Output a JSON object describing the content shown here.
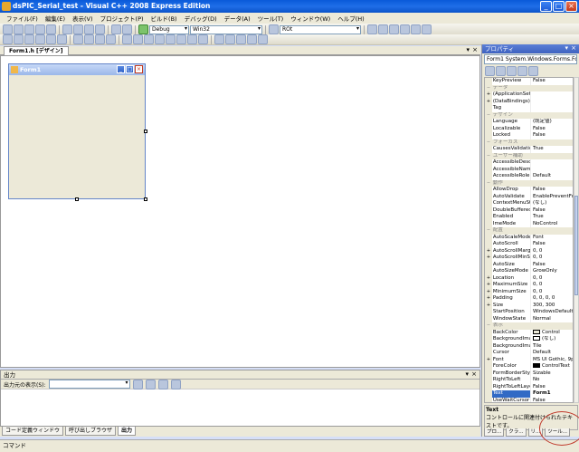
{
  "window": {
    "title": "dsPIC_Serial_test - Visual C++ 2008 Express Edition"
  },
  "menubar": [
    "ファイル(F)",
    "編集(E)",
    "表示(V)",
    "プロジェクト(P)",
    "ビルド(B)",
    "デバッグ(D)",
    "データ(A)",
    "ツール(T)",
    "ウィンドウ(W)",
    "ヘルプ(H)"
  ],
  "toolbar": {
    "config": "Debug",
    "platform": "Win32",
    "find_text": "ROt"
  },
  "document_tab": "Form1.h [デザイン]",
  "form1": {
    "title": "Form1"
  },
  "output": {
    "title": "出力",
    "source_label": "出力元の表示(S):"
  },
  "bottom_tabs": [
    "コード定義ウィンドウ",
    "呼び出しブラウザ",
    "出力"
  ],
  "status": "コマンド",
  "properties": {
    "title": "プロパティ",
    "object": "Form1 System.Windows.Forms.Form",
    "rows": [
      {
        "t": "p",
        "n": "KeyPreview",
        "v": "False"
      },
      {
        "t": "c",
        "n": "データ"
      },
      {
        "t": "p",
        "e": "+",
        "n": "(ApplicationSetti",
        "v": ""
      },
      {
        "t": "p",
        "e": "+",
        "n": "(DataBindings)",
        "v": ""
      },
      {
        "t": "p",
        "n": "Tag",
        "v": ""
      },
      {
        "t": "c",
        "n": "デザイン"
      },
      {
        "t": "p",
        "n": "Language",
        "v": "(既定値)"
      },
      {
        "t": "p",
        "n": "Localizable",
        "v": "False"
      },
      {
        "t": "p",
        "n": "Locked",
        "v": "False"
      },
      {
        "t": "c",
        "n": "フォーカス"
      },
      {
        "t": "p",
        "n": "CausesValidatio",
        "v": "True"
      },
      {
        "t": "c",
        "n": "ユーザー補助"
      },
      {
        "t": "p",
        "n": "AccessibleDescr",
        "v": ""
      },
      {
        "t": "p",
        "n": "AccessibleName",
        "v": ""
      },
      {
        "t": "p",
        "n": "AccessibleRole",
        "v": "Default"
      },
      {
        "t": "c",
        "n": "動作"
      },
      {
        "t": "p",
        "n": "AllowDrop",
        "v": "False"
      },
      {
        "t": "p",
        "n": "AutoValidate",
        "v": "EnablePreventFoc"
      },
      {
        "t": "p",
        "n": "ContextMenuStri",
        "v": "(なし)"
      },
      {
        "t": "p",
        "n": "DoubleBuffered",
        "v": "False"
      },
      {
        "t": "p",
        "n": "Enabled",
        "v": "True"
      },
      {
        "t": "p",
        "n": "ImeMode",
        "v": "NoControl"
      },
      {
        "t": "c",
        "n": "配置"
      },
      {
        "t": "p",
        "n": "AutoScaleMode",
        "v": "Font"
      },
      {
        "t": "p",
        "n": "AutoScroll",
        "v": "False"
      },
      {
        "t": "p",
        "e": "+",
        "n": "AutoScrollMargi",
        "v": "0, 0"
      },
      {
        "t": "p",
        "e": "+",
        "n": "AutoScrollMinSiz",
        "v": "0, 0"
      },
      {
        "t": "p",
        "n": "AutoSize",
        "v": "False"
      },
      {
        "t": "p",
        "n": "AutoSizeMode",
        "v": "GrowOnly"
      },
      {
        "t": "p",
        "e": "+",
        "n": "Location",
        "v": "0, 0"
      },
      {
        "t": "p",
        "e": "+",
        "n": "MaximumSize",
        "v": "0, 0"
      },
      {
        "t": "p",
        "e": "+",
        "n": "MinimumSize",
        "v": "0, 0"
      },
      {
        "t": "p",
        "e": "+",
        "n": "Padding",
        "v": "0, 0, 0, 0"
      },
      {
        "t": "p",
        "e": "+",
        "n": "Size",
        "v": "300, 300"
      },
      {
        "t": "p",
        "n": "StartPosition",
        "v": "WindowsDefaultLo"
      },
      {
        "t": "p",
        "n": "WindowState",
        "v": "Normal"
      },
      {
        "t": "c",
        "n": "表示"
      },
      {
        "t": "p",
        "n": "BackColor",
        "v": "Control",
        "sw": "#ece9d8"
      },
      {
        "t": "p",
        "n": "BackgroundImag",
        "v": "(なし)",
        "sw": "#ffffff"
      },
      {
        "t": "p",
        "n": "BackgroundImag",
        "v": "Tile"
      },
      {
        "t": "p",
        "n": "Cursor",
        "v": "Default"
      },
      {
        "t": "p",
        "e": "+",
        "n": "Font",
        "v": "MS UI Gothic, 9pt"
      },
      {
        "t": "p",
        "n": "ForeColor",
        "v": "ControlText",
        "sw": "#000000"
      },
      {
        "t": "p",
        "n": "FormBorderStyle",
        "v": "Sizable"
      },
      {
        "t": "p",
        "n": "RightToLeft",
        "v": "No"
      },
      {
        "t": "p",
        "n": "RightToLeftLayo",
        "v": "False"
      },
      {
        "t": "p",
        "n": "Text",
        "v": "Form1",
        "sel": true
      },
      {
        "t": "p",
        "n": "UseWaitCursor",
        "v": "False"
      }
    ],
    "description_title": "Text",
    "description_body": "コントロールに関連付けられたテキストです。",
    "tabs": [
      "プロ...",
      "クラ...",
      "リ...",
      "ツール..."
    ]
  }
}
